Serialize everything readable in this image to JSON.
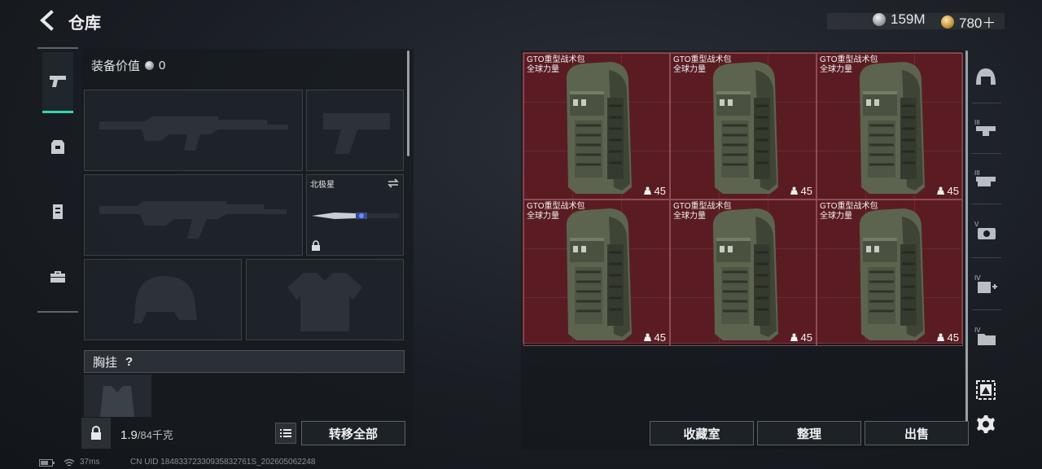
{
  "header": {
    "title": "仓库",
    "silver": "159M",
    "gold": "780＋"
  },
  "categories": [
    {
      "icon": "pistol-icon",
      "active": true
    },
    {
      "icon": "backpack-icon",
      "active": false
    },
    {
      "icon": "vest-icon",
      "active": false
    },
    {
      "icon": "toolbox-icon",
      "active": false
    }
  ],
  "equipment": {
    "value_label": "装备价值",
    "value": "0",
    "melee_name": "北极星",
    "chest_label": "胸挂",
    "chest_help": "?",
    "weight_current": "1.9",
    "weight_max": "/84千克",
    "transfer_all": "转移全部"
  },
  "storage": {
    "items": [
      {
        "line1": "GTO重型战术包",
        "line2": "全球力量",
        "count": "45"
      },
      {
        "line1": "GTO重型战术包",
        "line2": "全球力量",
        "count": "45"
      },
      {
        "line1": "GTO重型战术包",
        "line2": "全球力量",
        "count": "45"
      },
      {
        "line1": "GTO重型战术包",
        "line2": "全球力量",
        "count": "45"
      },
      {
        "line1": "GTO重型战术包",
        "line2": "全球力量",
        "count": "45"
      },
      {
        "line1": "GTO重型战术包",
        "line2": "全球力量",
        "count": "45"
      }
    ],
    "btn_collection": "收藏室",
    "btn_sort": "整理",
    "btn_sell": "出售"
  },
  "side_filters": [
    {
      "icon": "helmet-icon",
      "tier": ""
    },
    {
      "icon": "rig-tier3-icon",
      "tier": "III"
    },
    {
      "icon": "rig-tier3b-icon",
      "tier": "III"
    },
    {
      "icon": "case-tier5-icon",
      "tier": "V"
    },
    {
      "icon": "medkit-tier4-icon",
      "tier": "IV"
    },
    {
      "icon": "folder-tier4-icon",
      "tier": "IV"
    },
    {
      "icon": "select-all-icon",
      "tier": ""
    },
    {
      "icon": "gear-icon",
      "tier": ""
    }
  ],
  "status": {
    "ping": "37ms",
    "uid": "CN UID 18483372330935832761S_202605062248"
  }
}
